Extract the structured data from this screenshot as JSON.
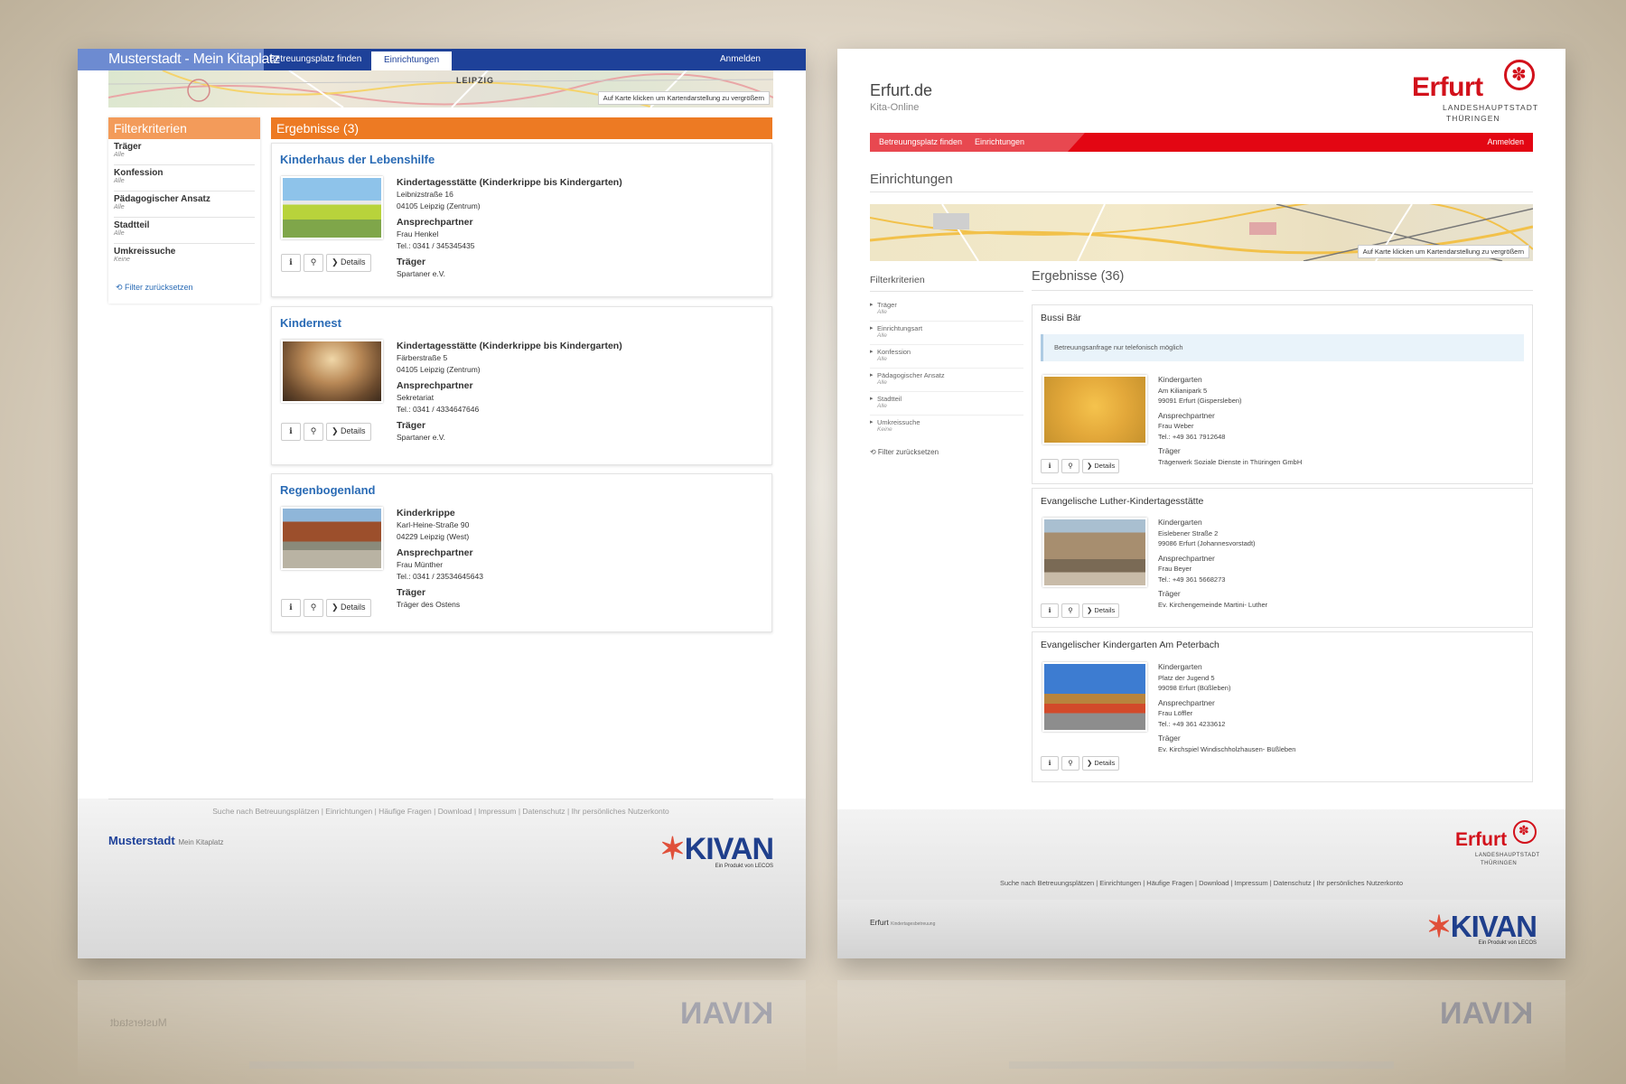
{
  "left": {
    "header": {
      "brand": "Musterstadt - Mein Kitaplatz",
      "nav": [
        "Betreuungsplatz finden",
        "Einrichtungen"
      ],
      "login": "Anmelden"
    },
    "map": {
      "city": "LEIPZIG",
      "tip": "Auf Karte klicken um Kartendarstellung zu vergrößern"
    },
    "filter": {
      "title": "Filterkriterien",
      "items": [
        {
          "label": "Träger",
          "value": "Alle"
        },
        {
          "label": "Konfession",
          "value": "Alle"
        },
        {
          "label": "Pädagogischer Ansatz",
          "value": "Alle"
        },
        {
          "label": "Stadtteil",
          "value": "Alle"
        },
        {
          "label": "Umkreissuche",
          "value": "Keine"
        }
      ],
      "reset": "⟲ Filter zurücksetzen"
    },
    "results": {
      "title": "Ergebnisse (3)",
      "details_label": "❯ Details",
      "info_icon": "ℹ",
      "pin_icon": "⚲",
      "cards": [
        {
          "name": "Kinderhaus der Lebenshilfe",
          "type": "Kindertagesstätte (Kinderkrippe bis Kindergarten)",
          "street": "Leibnizstraße 16",
          "city": "04105 Leipzig (Zentrum)",
          "contact_h": "Ansprechpartner",
          "contact": "Frau Henkel",
          "phone": "Tel.: 0341 / 345345435",
          "carrier_h": "Träger",
          "carrier": "Spartaner e.V."
        },
        {
          "name": "Kindernest",
          "type": "Kindertagesstätte (Kinderkrippe bis Kindergarten)",
          "street": "Färberstraße 5",
          "city": "04105 Leipzig (Zentrum)",
          "contact_h": "Ansprechpartner",
          "contact": "Sekretariat",
          "phone": "Tel.: 0341 / 4334647646",
          "carrier_h": "Träger",
          "carrier": "Spartaner e.V."
        },
        {
          "name": "Regenbogenland",
          "type": "Kinderkrippe",
          "street": "Karl-Heine-Straße 90",
          "city": "04229 Leipzig (West)",
          "contact_h": "Ansprechpartner",
          "contact": "Frau Münther",
          "phone": "Tel.: 0341 / 23534645643",
          "carrier_h": "Träger",
          "carrier": "Träger des Ostens"
        }
      ]
    },
    "footer": {
      "links": "Suche nach Betreuungsplätzen | Einrichtungen | Häufige Fragen | Download | Impressum | Datenschutz | Ihr persönliches Nutzerkonto",
      "brand": "Musterstadt",
      "brand_sub": "Mein Kitaplatz",
      "kivan": "KIVAN",
      "kivan_sub": "Ein Produkt von LECOS"
    }
  },
  "right": {
    "site": "Erfurt.de",
    "site_sub": "Kita-Online",
    "logo": {
      "word": "Erfurt",
      "line1": "LANDESHAUPTSTADT",
      "line2": "THÜRINGEN"
    },
    "nav": {
      "items": [
        "Betreuungsplatz finden",
        "Einrichtungen"
      ],
      "login": "Anmelden"
    },
    "heading": "Einrichtungen",
    "map": {
      "tip": "Auf Karte klicken um Kartendarstellung zu vergrößern"
    },
    "filter": {
      "title": "Filterkriterien",
      "items": [
        {
          "label": "Träger",
          "value": "Alle"
        },
        {
          "label": "Einrichtungsart",
          "value": "Alle"
        },
        {
          "label": "Konfession",
          "value": "Alle"
        },
        {
          "label": "Pädagogischer Ansatz",
          "value": "Alle"
        },
        {
          "label": "Stadtteil",
          "value": "Alle"
        },
        {
          "label": "Umkreissuche",
          "value": "Keine"
        }
      ],
      "reset": "⟲ Filter zurücksetzen"
    },
    "results": {
      "title": "Ergebnisse (36)",
      "details_label": "❯ Details",
      "info_icon": "ℹ",
      "pin_icon": "⚲",
      "cards": [
        {
          "name": "Bussi Bär",
          "notice": "Betreuungsanfrage nur telefonisch möglich",
          "type": "Kindergarten",
          "street": "Am Kilianipark 5",
          "city": "99091 Erfurt (Gispersleben)",
          "contact_h": "Ansprechpartner",
          "contact": "Frau Weber",
          "phone": "Tel.: +49 361 7912648",
          "carrier_h": "Träger",
          "carrier": "Trägerwerk Soziale Dienste in Thüringen GmbH"
        },
        {
          "name": "Evangelische Luther-Kindertagesstätte",
          "type": "Kindergarten",
          "street": "Eislebener Straße 2",
          "city": "99086 Erfurt (Johannesvorstadt)",
          "contact_h": "Ansprechpartner",
          "contact": "Frau Beyer",
          "phone": "Tel.: +49 361 5668273",
          "carrier_h": "Träger",
          "carrier": "Ev. Kirchengemeinde Martini- Luther"
        },
        {
          "name": "Evangelischer Kindergarten Am Peterbach",
          "type": "Kindergarten",
          "street": "Platz der Jugend 5",
          "city": "99098 Erfurt (Büßleben)",
          "contact_h": "Ansprechpartner",
          "contact": "Frau Löffler",
          "phone": "Tel.: +49 361 4233612",
          "carrier_h": "Träger",
          "carrier": "Ev. Kirchspiel Windischholzhausen- Büßleben"
        }
      ]
    },
    "footer": {
      "links": "Suche nach Betreuungsplätzen | Einrichtungen | Häufige Fragen | Download | Impressum | Datenschutz | Ihr persönliches Nutzerkonto",
      "brand": "Erfurt",
      "brand_sub": "Kindertagesbetreuung",
      "kivan": "KIVAN",
      "kivan_sub": "Ein Produkt von LECOS"
    }
  }
}
